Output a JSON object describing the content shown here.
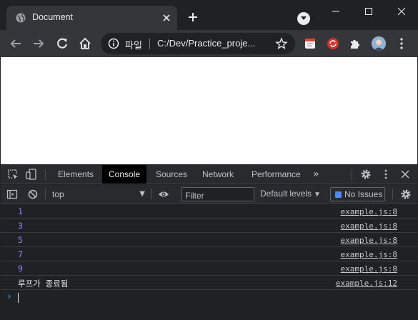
{
  "browser": {
    "tab_title": "Document",
    "address_scheme_label": "파일",
    "url": "C:/Dev/Practice_proje...",
    "window_controls": [
      "minimize-icon",
      "maximize-icon",
      "close-icon"
    ],
    "toolbar_icons": [
      "back-icon",
      "forward-icon",
      "reload-icon",
      "home-icon"
    ],
    "extension_icons": [
      "note-extension-icon",
      "sync-extension-icon",
      "puzzle-extension-icon"
    ]
  },
  "devtools": {
    "tabs": [
      {
        "label": "Elements",
        "active": false
      },
      {
        "label": "Console",
        "active": true
      },
      {
        "label": "Sources",
        "active": false
      },
      {
        "label": "Network",
        "active": false
      },
      {
        "label": "Performance",
        "active": false
      }
    ],
    "more_tabs": "»",
    "console_toolbar": {
      "context": "top",
      "filter_placeholder": "Filter",
      "levels_label": "Default levels",
      "issues_label": "No Issues"
    },
    "logs": [
      {
        "message": "1",
        "type": "number",
        "source": "example.js:8"
      },
      {
        "message": "3",
        "type": "number",
        "source": "example.js:8"
      },
      {
        "message": "5",
        "type": "number",
        "source": "example.js:8"
      },
      {
        "message": "7",
        "type": "number",
        "source": "example.js:8"
      },
      {
        "message": "9",
        "type": "number",
        "source": "example.js:8"
      },
      {
        "message": "루프가 종료됨",
        "type": "string",
        "source": "example.js:12"
      }
    ],
    "prompt_symbol": "›"
  },
  "colors": {
    "number_log": "#9980ff",
    "prompt": "#4b97f0",
    "issues_badge": "#4a8af4"
  }
}
